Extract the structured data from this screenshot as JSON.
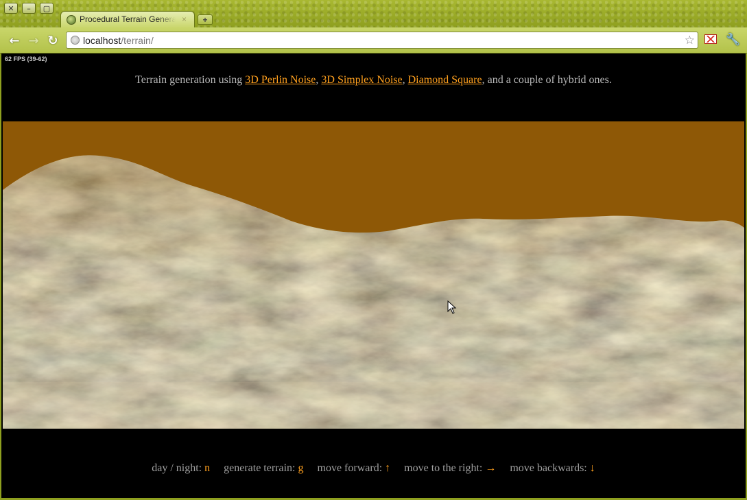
{
  "browser": {
    "tab_title": "Procedural Terrain Generation",
    "tab_close": "×",
    "new_tab": "+",
    "window_buttons": {
      "close": "✕",
      "minimize": "–",
      "maximize": "▢"
    },
    "url_host": "localhost",
    "url_path": "/terrain/",
    "nav": {
      "back": "←",
      "forward": "→",
      "reload": "↻"
    },
    "star": "☆",
    "wrench": "🔧"
  },
  "page": {
    "fps": "62 FPS (39-62)",
    "intro": {
      "prefix": "Terrain generation using ",
      "links": [
        "3D Perlin Noise",
        "3D Simplex Noise",
        "Diamond Square"
      ],
      "sep1": ", ",
      "sep2": ", ",
      "suffix": ", and a couple of hybrid ones."
    },
    "controls": [
      {
        "label": "day / night:",
        "key": "n"
      },
      {
        "label": "generate terrain:",
        "key": "g"
      },
      {
        "label": "move forward:",
        "key": "↑"
      },
      {
        "label": "move to the right:",
        "key": "→"
      },
      {
        "label": "move backwards:",
        "key": "↓"
      }
    ]
  },
  "colors": {
    "accent_link": "#ffa01e",
    "sky": "#8e5806",
    "chrome": "#a9b832"
  }
}
